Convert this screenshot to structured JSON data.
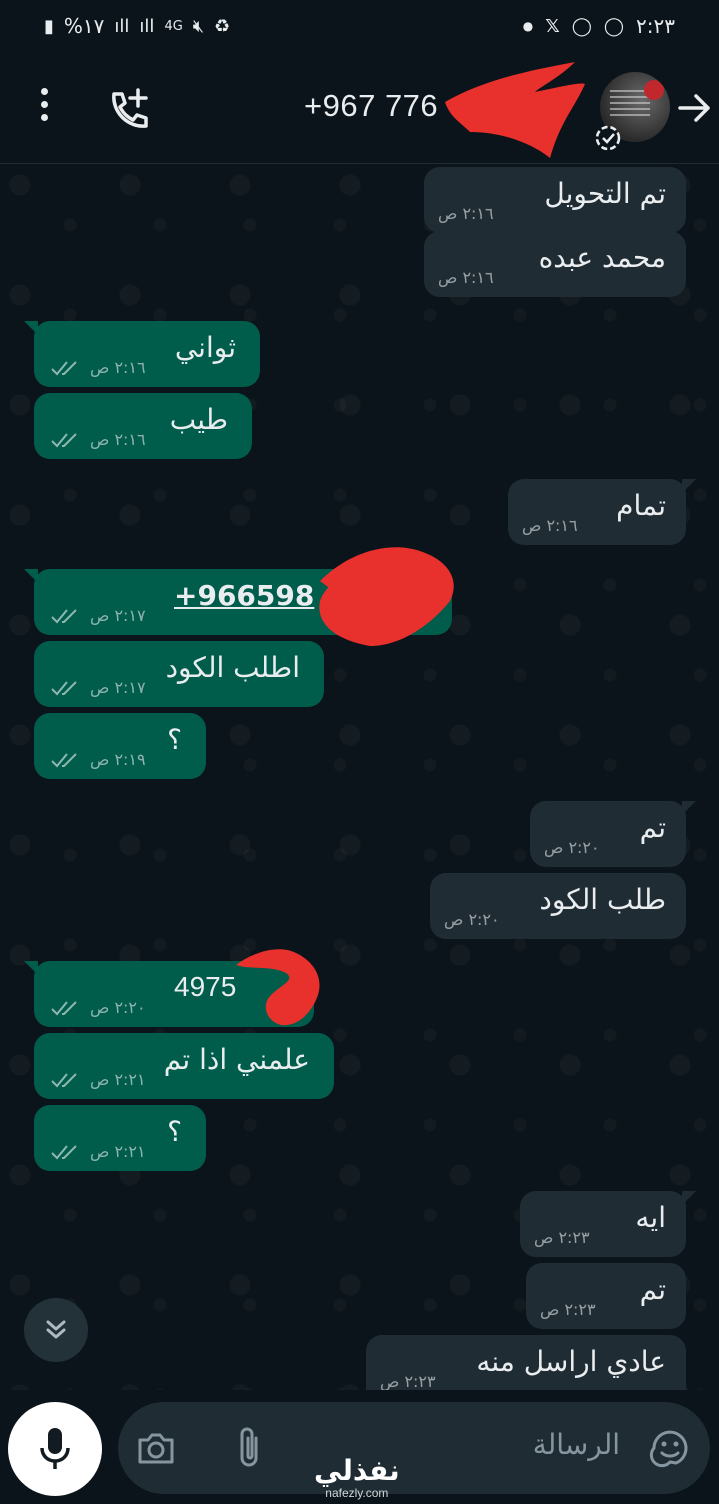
{
  "status_bar": {
    "time": "٢:٢٣",
    "battery": "%١٧",
    "network": "4G"
  },
  "header": {
    "contact_name": "+967 776",
    "back_icon": "arrow-right-icon",
    "add_call_icon": "add-call-icon",
    "menu_icon": "more-vert-icon"
  },
  "messages": [
    {
      "dir": "in",
      "text": "تم التحويل",
      "time": "٢:١٦ ص"
    },
    {
      "dir": "in",
      "text": "محمد عبده",
      "time": "٢:١٦ ص"
    },
    {
      "dir": "out",
      "text": "ثواني",
      "time": "٢:١٦ ص"
    },
    {
      "dir": "out",
      "text": "طيب",
      "time": "٢:١٦ ص"
    },
    {
      "dir": "in",
      "text": "تمام",
      "time": "٢:١٦ ص"
    },
    {
      "dir": "out",
      "text": "+966598",
      "time": "٢:١٧ ص"
    },
    {
      "dir": "out",
      "text": "اطلب الكود",
      "time": "٢:١٧ ص"
    },
    {
      "dir": "out",
      "text": "؟",
      "time": "٢:١٩ ص"
    },
    {
      "dir": "in",
      "text": "تم",
      "time": "٢:٢٠ ص"
    },
    {
      "dir": "in",
      "text": "طلب الكود",
      "time": "٢:٢٠ ص"
    },
    {
      "dir": "out",
      "text": "4975",
      "time": "٢:٢٠ ص"
    },
    {
      "dir": "out",
      "text": "علمني اذا تم",
      "time": "٢:٢١ ص"
    },
    {
      "dir": "out",
      "text": "؟",
      "time": "٢:٢١ ص"
    },
    {
      "dir": "in",
      "text": "ايه",
      "time": "٢:٢٣ ص"
    },
    {
      "dir": "in",
      "text": "تم",
      "time": "٢:٢٣ ص"
    },
    {
      "dir": "in",
      "text": "عادي اراسل منه",
      "time": "٢:٢٣ ص"
    }
  ],
  "input": {
    "placeholder": "الرسالة"
  },
  "watermark": {
    "arabic": "نفذلي",
    "latin": "nafezly.com"
  },
  "colors": {
    "background": "#0b141a",
    "incoming_bubble": "#202c33",
    "outgoing_bubble": "#005c4b",
    "link": "#53bdeb",
    "redaction": "#e8302c"
  }
}
